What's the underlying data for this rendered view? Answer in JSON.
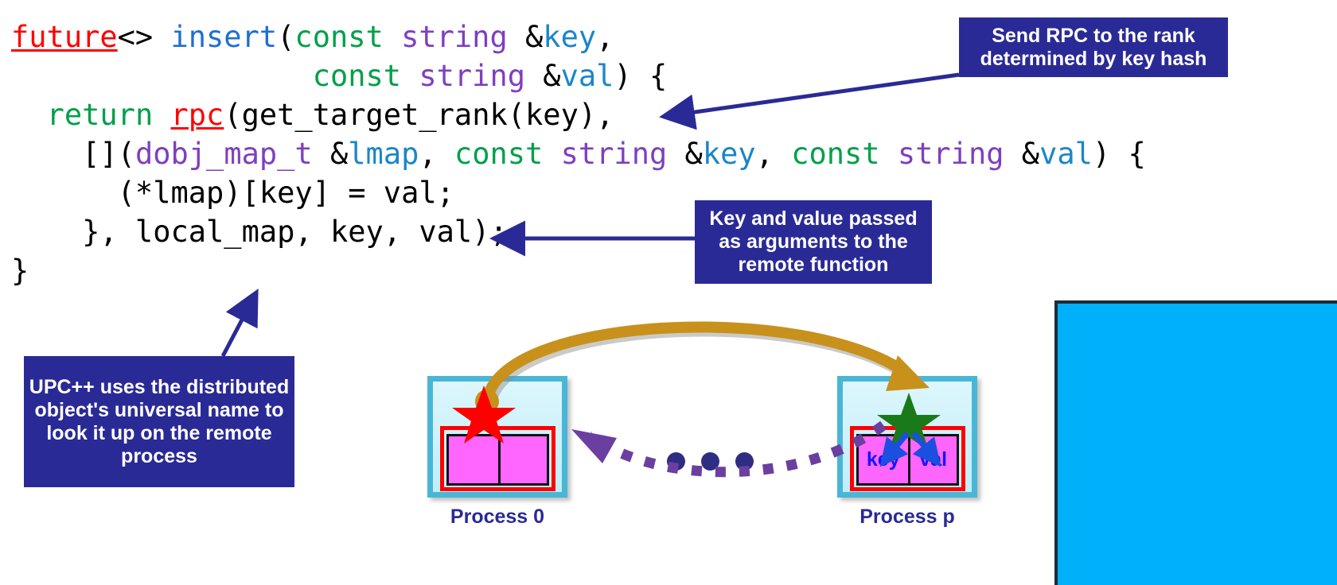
{
  "code": {
    "language": "cpp",
    "lines": [
      [
        {
          "text": "future",
          "role": "api-link"
        },
        {
          "text": "<> ",
          "role": "plain"
        },
        {
          "text": "insert",
          "role": "function"
        },
        {
          "text": "(",
          "role": "plain"
        },
        {
          "text": "const ",
          "role": "keyword"
        },
        {
          "text": "string ",
          "role": "type"
        },
        {
          "text": "&",
          "role": "plain"
        },
        {
          "text": "key",
          "role": "variable"
        },
        {
          "text": ",",
          "role": "plain"
        }
      ],
      [
        {
          "text": "                 ",
          "role": "plain"
        },
        {
          "text": "const ",
          "role": "keyword"
        },
        {
          "text": "string ",
          "role": "type"
        },
        {
          "text": "&",
          "role": "plain"
        },
        {
          "text": "val",
          "role": "variable"
        },
        {
          "text": ") {",
          "role": "plain"
        }
      ],
      [
        {
          "text": "  ",
          "role": "plain"
        },
        {
          "text": "return ",
          "role": "keyword"
        },
        {
          "text": "rpc",
          "role": "api-link"
        },
        {
          "text": "(get_target_rank(key),",
          "role": "plain"
        }
      ],
      [
        {
          "text": "    [](",
          "role": "plain"
        },
        {
          "text": "dobj_map_t ",
          "role": "type"
        },
        {
          "text": "&",
          "role": "plain"
        },
        {
          "text": "lmap",
          "role": "variable"
        },
        {
          "text": ", ",
          "role": "plain"
        },
        {
          "text": "const ",
          "role": "keyword"
        },
        {
          "text": "string ",
          "role": "type"
        },
        {
          "text": "&",
          "role": "plain"
        },
        {
          "text": "key",
          "role": "variable"
        },
        {
          "text": ", ",
          "role": "plain"
        },
        {
          "text": "const ",
          "role": "keyword"
        },
        {
          "text": "string ",
          "role": "type"
        },
        {
          "text": "&",
          "role": "plain"
        },
        {
          "text": "val",
          "role": "variable"
        },
        {
          "text": ") {",
          "role": "plain"
        }
      ],
      [
        {
          "text": "      (*lmap)[key] = val;",
          "role": "plain"
        }
      ],
      [
        {
          "text": "    }, local_map, key, val);",
          "role": "plain"
        }
      ],
      [
        {
          "text": "}",
          "role": "plain"
        }
      ]
    ]
  },
  "callouts": {
    "rpc": "Send RPC to the rank determined by key hash",
    "arguments": "Key and value passed as arguments to the remote function",
    "upcxx": "UPC++ uses the distributed object's universal name to look it up on the remote process"
  },
  "diagram": {
    "process_left": {
      "label": "Process 0",
      "star_color": "#ff0000",
      "cells": [
        "",
        ""
      ]
    },
    "process_right": {
      "label": "Process p",
      "star_color": "#1a7a1a",
      "cells": [
        "key",
        "val"
      ]
    },
    "ellipsis": "• • •",
    "rpc_arrow_color": "#c8911b",
    "lookup_arrow_color": "#6b3fa0",
    "insert_arrow_color": "#1a4fe0"
  },
  "colors": {
    "callout_bg": "#2a2a96",
    "callout_text": "#ffffff",
    "arrow_navy": "#2a2a96",
    "cyan_panel": "#00b0fa",
    "process_border": "#49b6d6",
    "process_fill": "#ddf6fd",
    "map_border": "#ff0000",
    "cell_fill": "#ff66ff",
    "cell_text": "#1414ff",
    "code_api": "#ff0000",
    "code_keyword": "#00a04a",
    "code_function": "#1f6fd0",
    "code_type": "#7f3fbf",
    "code_variable": "#1b86c8",
    "code_plain": "#000000"
  }
}
